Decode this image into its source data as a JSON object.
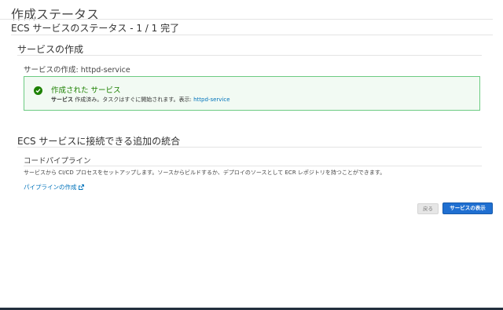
{
  "page": {
    "title": "作成ステータス"
  },
  "status": {
    "heading": "ECS サービスのステータス - 1 / 1 完了"
  },
  "service_creation": {
    "title": "サービスの作成",
    "subtitle": "サービスの作成: httpd-service",
    "alert": {
      "icon": "check-circle-icon",
      "title": "作成された サービス",
      "message_bold": "サービス",
      "message_text": " 作成済み。タスクはすぐに開始されます。表示: ",
      "message_link": "httpd-service"
    }
  },
  "integrations": {
    "title": "ECS サービスに接続できる追加の統合",
    "code_pipeline": {
      "title": "コードパイプライン",
      "description": "サービスから CI/CD プロセスをセットアップします。ソースからビルドするか、デプロイのソースとして ECR レポジトリを持つことができます。",
      "link_label": "パイプラインの作成"
    }
  },
  "actions": {
    "back_label": "戻る",
    "view_service_label": "サービスの表示"
  },
  "colors": {
    "success": "#1d8102",
    "link": "#0073bb",
    "primary_button": "#1f6fd1"
  }
}
